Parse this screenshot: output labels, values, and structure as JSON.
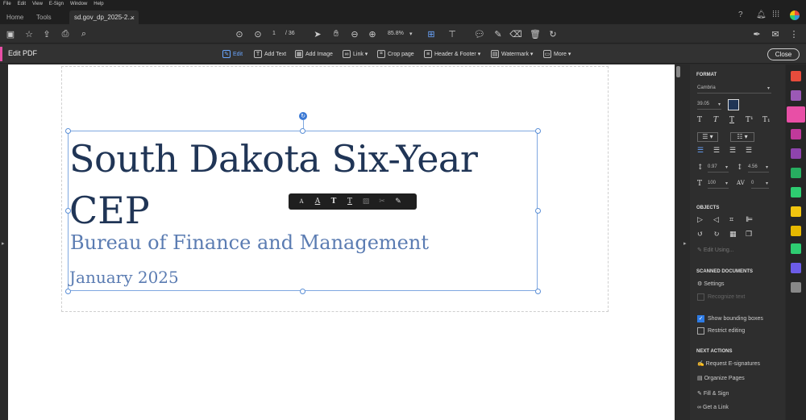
{
  "menu": [
    "File",
    "Edit",
    "View",
    "E-Sign",
    "Window",
    "Help"
  ],
  "tabs": {
    "home": "Home",
    "tools": "Tools",
    "doc": "sd.gov_dp_2025-2...",
    "close": "×"
  },
  "toolbar": {
    "page_current": "1",
    "page_total": "/ 36",
    "zoom": "85.8%"
  },
  "editbar": {
    "title": "Edit PDF",
    "tools": [
      "Edit",
      "Add Text",
      "Add Image",
      "Link ▾",
      "Crop page",
      "Header & Footer ▾",
      "Watermark ▾",
      "More ▾"
    ],
    "close": "Close"
  },
  "document": {
    "title_line1": "South Dakota Six-Year",
    "title_line2": "CEP",
    "subtitle": "Bureau of Finance and Management",
    "date": "January 2025"
  },
  "float_toolbar": [
    "A",
    "A",
    "T",
    "T",
    "▨",
    "✂",
    "✎"
  ],
  "panel": {
    "format_heading": "FORMAT",
    "font": "Cambria",
    "font_size": "39.05",
    "line_spacing": "0.97",
    "para_spacing": "4.56",
    "scale": "100",
    "char_spacing": "0",
    "objects_heading": "OBJECTS",
    "edit_using": "Edit Using...",
    "scanned_heading": "SCANNED DOCUMENTS",
    "settings": "Settings",
    "recognize": "Recognize text",
    "show_boxes": "Show bounding boxes",
    "restrict": "Restrict editing",
    "next_heading": "NEXT ACTIONS",
    "actions": [
      "Request E-signatures",
      "Organize Pages",
      "Fill & Sign",
      "Get a Link"
    ]
  },
  "colors": {
    "accent": "#e84fa6",
    "title": "#203556",
    "subtitle": "#5b7cb2",
    "selection": "#7fa8e0"
  }
}
